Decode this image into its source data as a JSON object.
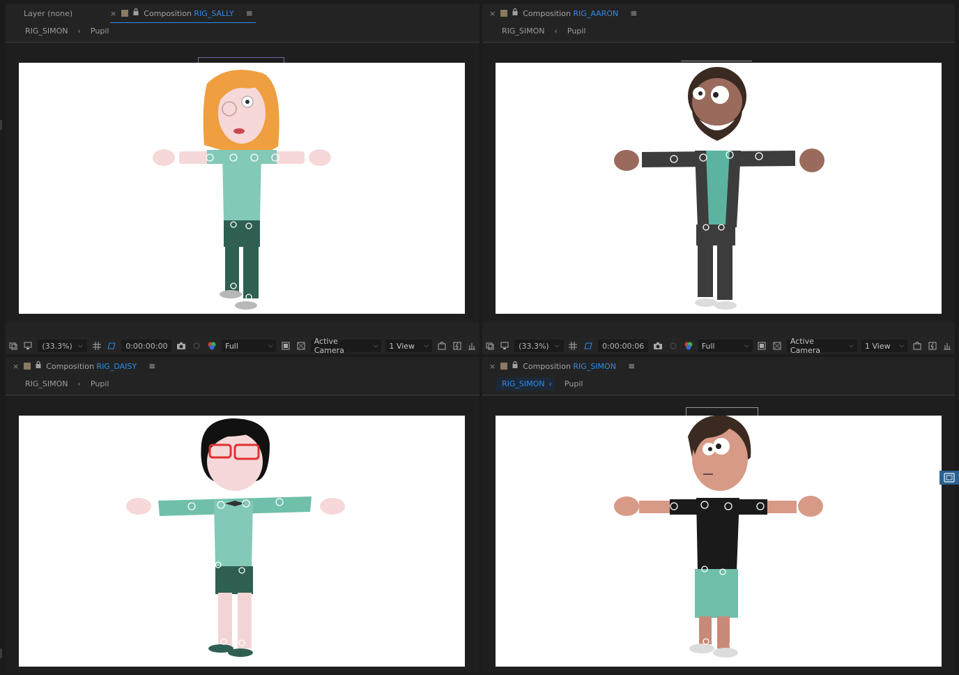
{
  "panels": {
    "sally": {
      "layer_tab": "Layer (none)",
      "title_prefix": "Composition",
      "comp_name": "RIG_SALLY",
      "breadcrumb_root": "RIG_SIMON",
      "breadcrumb_child": "Pupil",
      "zoom": "(33.3%)",
      "timecode": "0:00:00:00",
      "resolution": "Full",
      "camera": "Active Camera",
      "views": "1 View"
    },
    "aaron": {
      "title_prefix": "Composition",
      "comp_name": "RIG_AARON",
      "breadcrumb_root": "RIG_SIMON",
      "breadcrumb_child": "Pupil",
      "zoom": "(33.3%)",
      "timecode": "0:00:00:06",
      "resolution": "Full",
      "camera": "Active Camera",
      "views": "1 View"
    },
    "daisy": {
      "title_prefix": "Composition",
      "comp_name": "RIG_DAISY",
      "breadcrumb_root": "RIG_SIMON",
      "breadcrumb_child": "Pupil"
    },
    "simon": {
      "title_prefix": "Composition",
      "comp_name": "RIG_SIMON",
      "breadcrumb_root": "RIG_SIMON",
      "breadcrumb_child": "Pupil"
    }
  },
  "icons": {
    "close": "close-icon",
    "label_swatch": "label-color-swatch",
    "lock": "lock-icon",
    "panel_menu": "hamburger-menu-icon",
    "breadcrumb_arrow": "chevron-left-icon",
    "snapshot": "camera-icon",
    "channels": "rgb-channels-icon"
  },
  "colors": {
    "accent": "#2d8ceb",
    "panel_bg": "#232323",
    "stage": "#ffffff",
    "label_swatch": "#8a7a62"
  }
}
